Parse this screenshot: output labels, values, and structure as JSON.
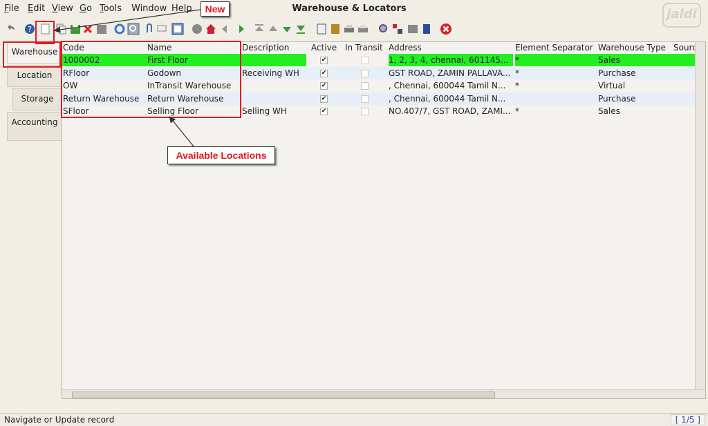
{
  "window": {
    "title": "Warehouse & Locators",
    "logo": "jaldi"
  },
  "menu": [
    {
      "label": "File",
      "underline": "F",
      "rest": "ile"
    },
    {
      "label": "Edit",
      "underline": "E",
      "rest": "dit"
    },
    {
      "label": "View",
      "underline": "V",
      "rest": "iew"
    },
    {
      "label": "Go",
      "underline": "G",
      "rest": "o"
    },
    {
      "label": "Tools",
      "underline": "T",
      "rest": "ools"
    },
    {
      "label": "Window",
      "underline": "",
      "rest": "Window"
    },
    {
      "label": "Help",
      "underline": "",
      "rest": "Help"
    }
  ],
  "toolbar": {
    "icons": [
      "undo-icon",
      "help-icon",
      "new-record-icon",
      "copy-icon",
      "save-icon",
      "delete-icon",
      "delete-selection-icon",
      "refresh-icon",
      "find-icon",
      "attachment-icon",
      "chat-icon",
      "grid-toggle-icon",
      "history-icon",
      "home-icon",
      "previous-icon",
      "next-icon",
      "first-record-icon",
      "previous-record-icon",
      "next-record-icon",
      "last-record-icon",
      "report-icon",
      "archive-icon",
      "print-icon",
      "print-preview-icon",
      "zoom-across-icon",
      "request-icon",
      "product-info-icon",
      "workflow-icon",
      "close-window-icon"
    ]
  },
  "tabs": [
    {
      "label": "Warehouse",
      "active": true
    },
    {
      "label": "Location",
      "active": false
    },
    {
      "label": "Storage",
      "active": false
    },
    {
      "label": "Accounting",
      "active": false
    }
  ],
  "grid": {
    "columns": [
      "Code",
      "Name",
      "Description",
      "Active",
      "In Transit",
      "Address",
      "Element Separator",
      "Warehouse Type",
      "Source"
    ],
    "rows": [
      {
        "code": "1000002",
        "name": "First Floor",
        "description": "",
        "active": true,
        "in_transit": false,
        "address": "1, 2, 3, 4, chennai,  601145...",
        "separator": "*",
        "type": "Sales",
        "selected": true
      },
      {
        "code": "RFloor",
        "name": "Godown",
        "description": "Receiving WH",
        "active": true,
        "in_transit": false,
        "address": "GST ROAD, ZAMIN PALLAVA...",
        "separator": "*",
        "type": "Purchase",
        "selected": false
      },
      {
        "code": "OW",
        "name": "InTransit Warehouse",
        "description": "",
        "active": true,
        "in_transit": false,
        "address": ", Chennai,  600044 Tamil N...",
        "separator": "*",
        "type": "Virtual",
        "selected": false
      },
      {
        "code": "Return Warehouse",
        "name": "Return Warehouse",
        "description": "",
        "active": true,
        "in_transit": false,
        "address": ", Chennai,  600044 Tamil N...",
        "separator": "",
        "type": "Purchase",
        "selected": false
      },
      {
        "code": "SFloor",
        "name": "Selling Floor",
        "description": "Selling WH",
        "active": true,
        "in_transit": false,
        "address": "NO.407/7, GST ROAD, ZAMI...",
        "separator": "*",
        "type": "Sales",
        "selected": false
      }
    ],
    "check_glyph": "✔"
  },
  "annotations": {
    "new_label": "New",
    "locations_label": "Available Locations"
  },
  "status": {
    "message": "Navigate or Update record",
    "record_count": "[ 1/5 ]"
  },
  "colors": {
    "selected_row": "#22ee22",
    "alt_row": "#e6eef8",
    "annotation": "#e01b24"
  }
}
